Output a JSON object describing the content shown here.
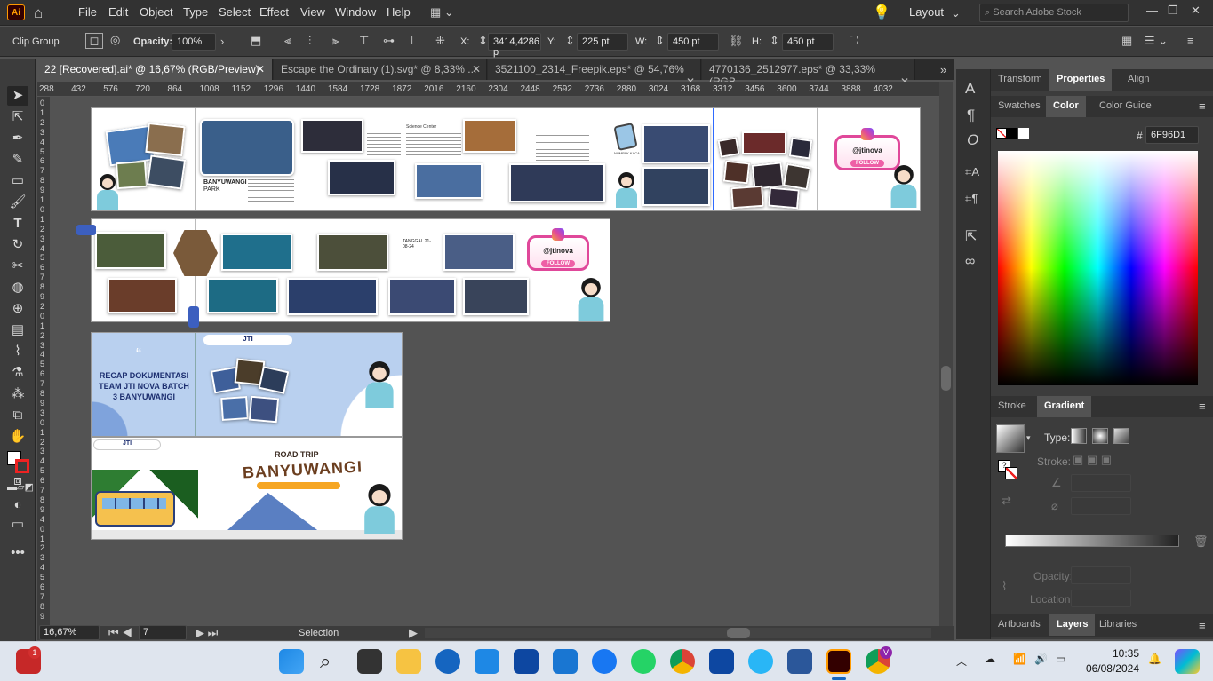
{
  "app": {
    "logo": "Ai"
  },
  "menu": [
    "File",
    "Edit",
    "Object",
    "Type",
    "Select",
    "Effect",
    "View",
    "Window",
    "Help"
  ],
  "workspace": {
    "label": "Layout",
    "search_placeholder": "Search Adobe Stock"
  },
  "control": {
    "selection_label": "Clip Group",
    "opacity_label": "Opacity:",
    "opacity_value": "100%",
    "x_label": "X:",
    "x_value": "3414,4286 p",
    "y_label": "Y:",
    "y_value": "225 pt",
    "w_label": "W:",
    "w_value": "450 pt",
    "h_label": "H:",
    "h_value": "450 pt"
  },
  "tabs": [
    {
      "label": "22 [Recovered].ai* @ 16,67% (RGB/Preview)"
    },
    {
      "label": "Escape the Ordinary (1).svg* @ 8,33% ..."
    },
    {
      "label": "3521100_2314_Freepik.eps* @ 54,76% ..."
    },
    {
      "label": "4770136_2512977.eps* @ 33,33% (RGB..."
    }
  ],
  "ruler_h": [
    "288",
    "432",
    "576",
    "720",
    "864",
    "1008",
    "1152",
    "1296",
    "1440",
    "1584",
    "1728",
    "1872",
    "2016",
    "2160",
    "2304",
    "2448",
    "2592",
    "2736",
    "2880",
    "3024",
    "3168",
    "3312",
    "3456",
    "3600",
    "3744",
    "3888",
    "4032"
  ],
  "ruler_v": [
    "0",
    "1",
    "2",
    "3",
    "4",
    "5",
    "6",
    "7",
    "8",
    "9",
    "1",
    "0",
    "1",
    "2",
    "3",
    "4",
    "5",
    "6",
    "7",
    "8",
    "9",
    "2",
    "0",
    "1",
    "2",
    "3",
    "4",
    "5",
    "6",
    "7",
    "8",
    "9",
    "3",
    "0",
    "1",
    "2",
    "3",
    "4",
    "5",
    "6",
    "7",
    "8",
    "9",
    "4",
    "0",
    "1",
    "2",
    "3",
    "4",
    "5",
    "6",
    "7",
    "8",
    "9"
  ],
  "artwork": {
    "page1_title": "BANYUWANGI",
    "page1_sub": "PARK",
    "follow_handle": "@jtinova",
    "follow_button": "FOLLOW",
    "cover_text": "RECAP DOKUMENTASI TEAM JTI NOVA BATCH 3 BANYUWANGI",
    "roadtrip_small": "ROAD TRIP",
    "roadtrip_title": "BANYUWANGI",
    "date_note": "TANGGAL 21-08-24",
    "logo": "JTI",
    "quote_mark": "“",
    "note_label": "Science Center",
    "bingo_label": "NUMPAK KACA"
  },
  "statusbar": {
    "zoom": "16,67%",
    "artboard": "7",
    "mode": "Selection"
  },
  "panel_tabs_top": [
    "Transform",
    "Properties",
    "Align"
  ],
  "panel_tabs_color": [
    "Swatches",
    "Color",
    "Color Guide"
  ],
  "color_hex_label": "#",
  "color_hex": "6F96D1",
  "panel_tabs_stroke": [
    "Stroke",
    "Gradient"
  ],
  "gradient": {
    "type_label": "Type:",
    "stroke_label": "Stroke:",
    "opacity_label": "Opacity:",
    "location_label": "Location:"
  },
  "panel_tabs_bottom": [
    "Artboards",
    "Layers",
    "Libraries"
  ],
  "taskbar": {
    "time": "10:35",
    "date": "06/08/2024",
    "badge": "1",
    "chrome_badge": "V"
  },
  "colors": {
    "accent": "#6F96D1",
    "ai_orange": "#ff9a00",
    "selection_blue": "#2f6bff"
  }
}
